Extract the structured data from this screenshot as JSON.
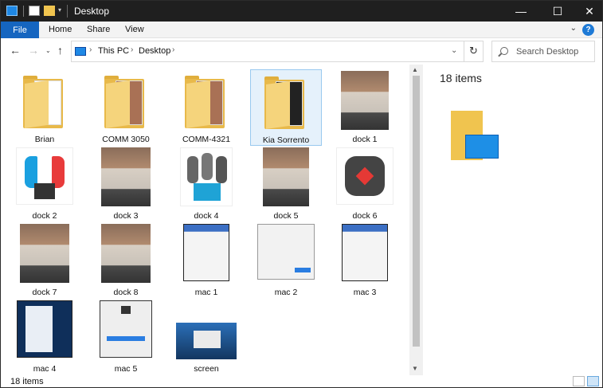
{
  "window": {
    "title": "Desktop"
  },
  "ribbon": {
    "tabs": [
      "File",
      "Home",
      "Share",
      "View"
    ]
  },
  "address": {
    "crumbs": [
      "This PC",
      "Desktop"
    ]
  },
  "search": {
    "placeholder": "Search Desktop"
  },
  "items": [
    {
      "label": "Brian",
      "type": "folder"
    },
    {
      "label": "COMM 3050",
      "type": "folder"
    },
    {
      "label": "COMM-4321",
      "type": "folder"
    },
    {
      "label": "Kia Sorrento",
      "type": "folder",
      "selected": true
    },
    {
      "label": "dock 1",
      "type": "photo"
    },
    {
      "label": "dock 2",
      "type": "photo"
    },
    {
      "label": "dock 3",
      "type": "photo"
    },
    {
      "label": "dock 4",
      "type": "photo"
    },
    {
      "label": "dock 5",
      "type": "photo"
    },
    {
      "label": "dock 6",
      "type": "photo"
    },
    {
      "label": "dock 7",
      "type": "photo"
    },
    {
      "label": "dock 8",
      "type": "photo"
    },
    {
      "label": "mac 1",
      "type": "screenshot"
    },
    {
      "label": "mac 2",
      "type": "screenshot"
    },
    {
      "label": "mac 3",
      "type": "screenshot"
    },
    {
      "label": "mac 4",
      "type": "screenshot"
    },
    {
      "label": "mac 5",
      "type": "screenshot"
    },
    {
      "label": "screen",
      "type": "screenshot"
    }
  ],
  "preview": {
    "count": "18 items"
  },
  "status": {
    "count": "18 items"
  },
  "colors": {
    "accent": "#1565c0",
    "selection": "#e5f1fb",
    "folder": "#e8b94a"
  }
}
